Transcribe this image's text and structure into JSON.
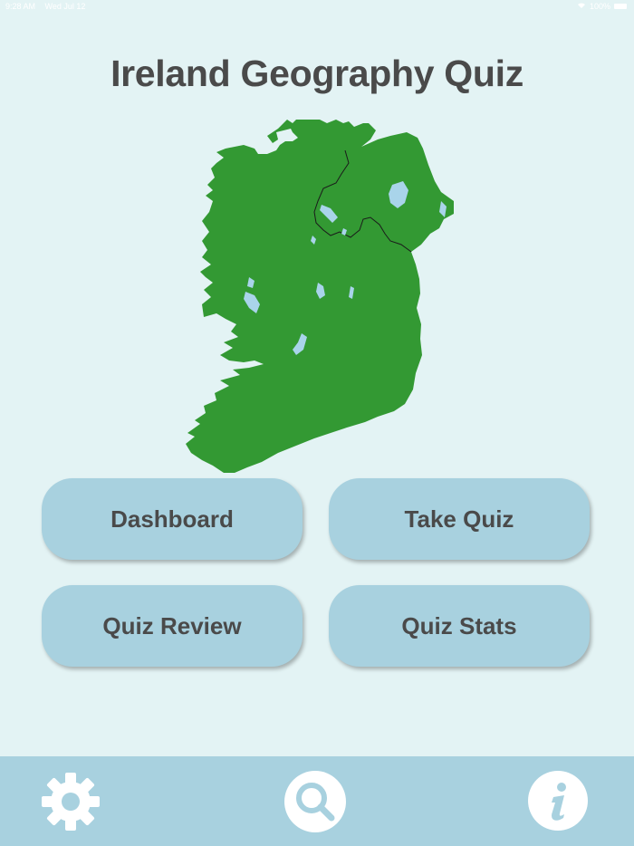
{
  "status_bar": {
    "time": "9:28 AM",
    "date": "Wed Jul 12",
    "battery": "100%"
  },
  "title": "Ireland Geography Quiz",
  "map": {
    "land_color": "#339933",
    "lake_color": "#a9d4ea",
    "background": "#e3f3f4"
  },
  "buttons": {
    "dashboard": "Dashboard",
    "take_quiz": "Take Quiz",
    "quiz_review": "Quiz Review",
    "quiz_stats": "Quiz Stats",
    "color": "#a8d1df"
  },
  "tabbar": {
    "color": "#a8d1df",
    "icons": [
      "gear-icon",
      "search-icon",
      "info-icon"
    ]
  }
}
